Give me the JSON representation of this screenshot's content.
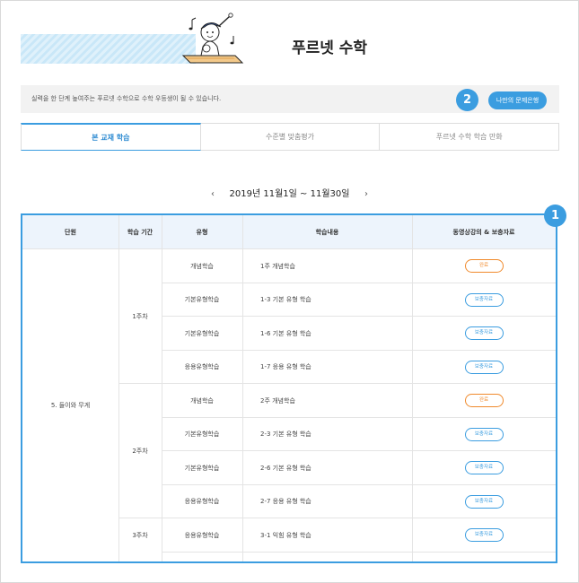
{
  "header": {
    "title": "푸르넷 수학"
  },
  "intro": {
    "text": "실력을 한 단계 높여주는 푸르넷 수학으로 수학 우등생이 될 수 있습니다.",
    "badge": "2",
    "bank_button": "나만의 문제은행"
  },
  "tabs": [
    {
      "label": "본 교재 학습",
      "active": true
    },
    {
      "label": "수준별 맞춤평가",
      "active": false
    },
    {
      "label": "푸르넷 수학 학습 만화",
      "active": false
    }
  ],
  "date_nav": {
    "prev": "‹",
    "range": "2019년 11월1일 ~ 11월30일",
    "next": "›"
  },
  "table": {
    "badge": "1",
    "headers": [
      "단원",
      "학습 기간",
      "유형",
      "학습내용",
      "동영상강의 & 보충자료"
    ],
    "unit": "5. 들이와 무게",
    "weeks": [
      "1주차",
      "2주차",
      "3주차"
    ],
    "rows": [
      {
        "type": "개념학습",
        "content": "1주 개념학습",
        "action": "완료",
        "status": "done"
      },
      {
        "type": "기본유형학습",
        "content": "1-3 기본 유형 학습",
        "action": "보충자료",
        "status": "supp"
      },
      {
        "type": "기본유형학습",
        "content": "1-6 기본 유형 학습",
        "action": "보충자료",
        "status": "supp"
      },
      {
        "type": "응용유형학습",
        "content": "1-7 응용 유형 학습",
        "action": "보충자료",
        "status": "supp"
      },
      {
        "type": "개념학습",
        "content": "2주 개념학습",
        "action": "완료",
        "status": "done"
      },
      {
        "type": "기본유형학습",
        "content": "2-3 기본 유형 학습",
        "action": "보충자료",
        "status": "supp"
      },
      {
        "type": "기본유형학습",
        "content": "2-6 기본 유형 학습",
        "action": "보충자료",
        "status": "supp"
      },
      {
        "type": "응용유형학습",
        "content": "2-7 응용 유형 학습",
        "action": "보충자료",
        "status": "supp"
      },
      {
        "type": "응용유형학습",
        "content": "3-1 익힘 유형 학습",
        "action": "보충자료",
        "status": "supp"
      }
    ]
  },
  "colors": {
    "accent": "#3b9de0",
    "done": "#f08a2c",
    "header_bg": "#edf4fc"
  },
  "icons": {
    "mascot": "student-writing-mascot-icon"
  }
}
